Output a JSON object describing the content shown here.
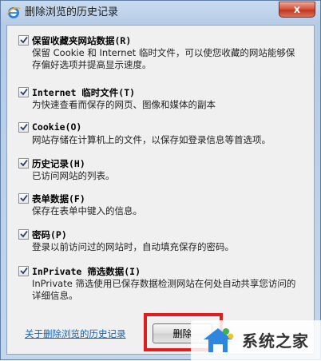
{
  "window": {
    "title": "删除浏览的历史记录",
    "close_glyph": "x"
  },
  "options": [
    {
      "checked": true,
      "title": "保留收藏夹网站数据(R)",
      "desc": "保留 Cookie 和 Internet 临时文件，可以使您收藏的网站能够保存偏好选项并提高显示速度。"
    },
    {
      "checked": true,
      "title": "Internet 临时文件(T)",
      "desc": "为快速查看而保存的网页、图像和媒体的副本"
    },
    {
      "checked": true,
      "title": "Cookie(O)",
      "desc": "网站存储在计算机上的文件，以保存如登录信息等首选项。"
    },
    {
      "checked": true,
      "title": "历史记录(H)",
      "desc": "已访问网站的列表。"
    },
    {
      "checked": true,
      "title": "表单数据(F)",
      "desc": "保存在表单中键入的信息。"
    },
    {
      "checked": true,
      "title": "密码(P)",
      "desc": "登录以前访问过的网站时，自动填充保存的密码。"
    },
    {
      "checked": true,
      "title": "InPrivate 筛选数据(I)",
      "desc": "InPrivate 筛选使用已保存数据检测网站在何处自动共享您访问的详细信息。"
    }
  ],
  "footer": {
    "link_text": "关于删除浏览的历史记录",
    "delete_button_label": "删除"
  },
  "watermark": {
    "text": "系统之家"
  },
  "colors": {
    "highlight": "#e01c1c",
    "link": "#1560b0",
    "close": "#c2361e"
  }
}
